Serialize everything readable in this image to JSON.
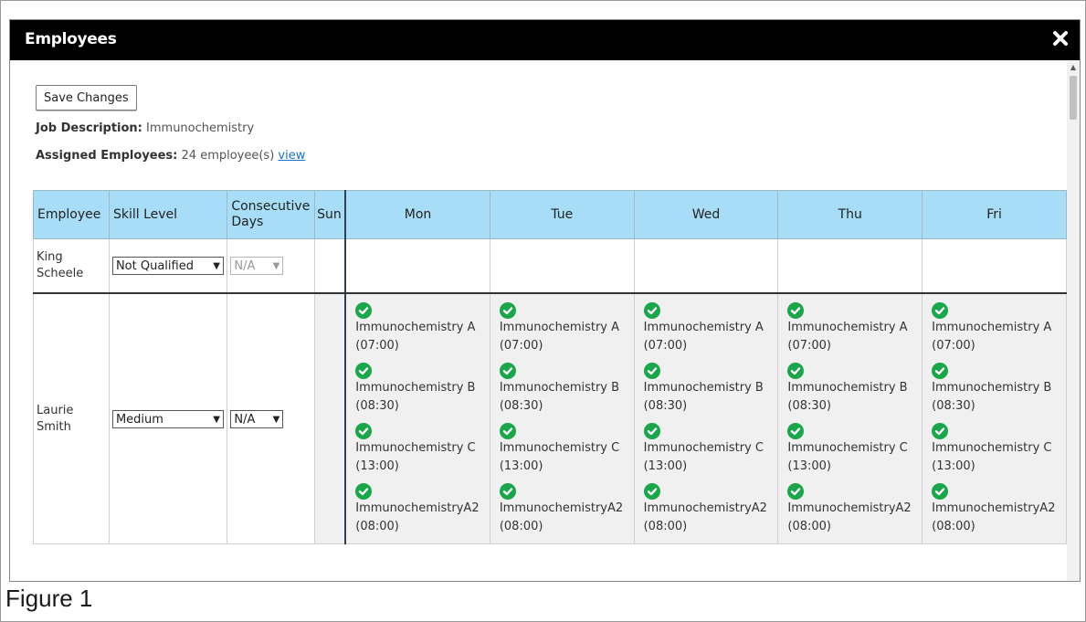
{
  "modal": {
    "title": "Employees",
    "save_label": "Save Changes",
    "job_label": "Job Description:",
    "job_value": "Immunochemistry",
    "assigned_label": "Assigned Employees:",
    "assigned_value": "24 employee(s)",
    "view_link": "view"
  },
  "table": {
    "headers": [
      "Employee",
      "Skill Level",
      "Consecutive Days",
      "Sun",
      "Mon",
      "Tue",
      "Wed",
      "Thu",
      "Fri"
    ],
    "rows": [
      {
        "name": "King Scheele",
        "skill": "Not Qualified",
        "consecutive": "N/A",
        "consecutive_disabled": true,
        "shifts": []
      },
      {
        "name": "Laurie Smith",
        "skill": "Medium",
        "consecutive": "N/A",
        "consecutive_disabled": false,
        "shifts": [
          {
            "name": "Immunochemistry A",
            "time": "(07:00)"
          },
          {
            "name": "Immunochemistry B",
            "time": "(08:30)"
          },
          {
            "name": "Immunochemistry C",
            "time": "(13:00)"
          },
          {
            "name": "ImmunochemistryA2",
            "time": "(08:00)"
          }
        ]
      }
    ]
  },
  "colors": {
    "header_bg": "#000000",
    "table_header": "#a7ddf6",
    "check": "#1aa64a",
    "link": "#1a73c9"
  },
  "icons": {
    "close": "close-icon",
    "check": "check-circle-icon",
    "dropdown": "chevron-down-icon"
  },
  "caption": "Figure 1"
}
